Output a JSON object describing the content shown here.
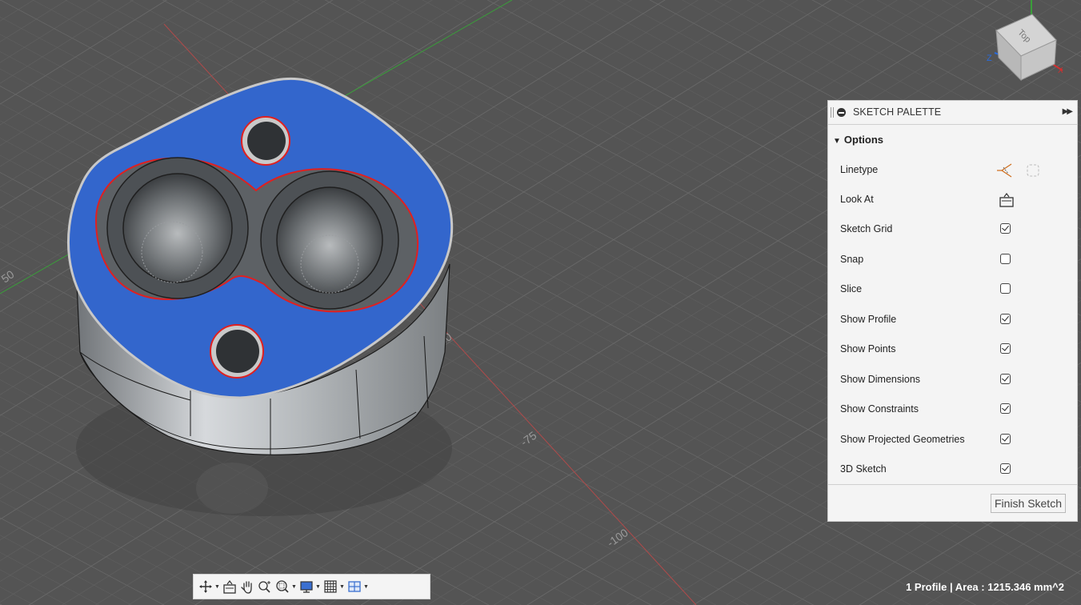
{
  "viewport": {
    "axis_labels": [
      "50",
      "50",
      "-75",
      "-100"
    ],
    "view_cube": {
      "face_label": "Top",
      "axis_z": "Z",
      "axis_x": "X"
    }
  },
  "palette": {
    "title": "SKETCH PALETTE",
    "section": "Options",
    "rows": [
      {
        "label": "Linetype",
        "type": "icons"
      },
      {
        "label": "Look At",
        "type": "icon"
      },
      {
        "label": "Sketch Grid",
        "checked": true
      },
      {
        "label": "Snap",
        "checked": false
      },
      {
        "label": "Slice",
        "checked": false
      },
      {
        "label": "Show Profile",
        "checked": true
      },
      {
        "label": "Show Points",
        "checked": true
      },
      {
        "label": "Show Dimensions",
        "checked": true
      },
      {
        "label": "Show Constraints",
        "checked": true
      },
      {
        "label": "Show Projected Geometries",
        "checked": true
      },
      {
        "label": "3D Sketch",
        "checked": true
      }
    ],
    "finish_label": "Finish Sketch"
  },
  "toolbar": {
    "icons": [
      "orbit-icon",
      "look-at-icon",
      "pan-icon",
      "zoom-icon",
      "fit-icon",
      "display-settings-icon",
      "grid-settings-icon",
      "viewports-icon"
    ]
  },
  "status": {
    "text": "1 Profile | Area : 1215.346 mm^2"
  },
  "colors": {
    "background": "#545454",
    "profile_fill": "#3366cc",
    "profile_edge": "#e02020",
    "panel": "#f4f4f4"
  }
}
